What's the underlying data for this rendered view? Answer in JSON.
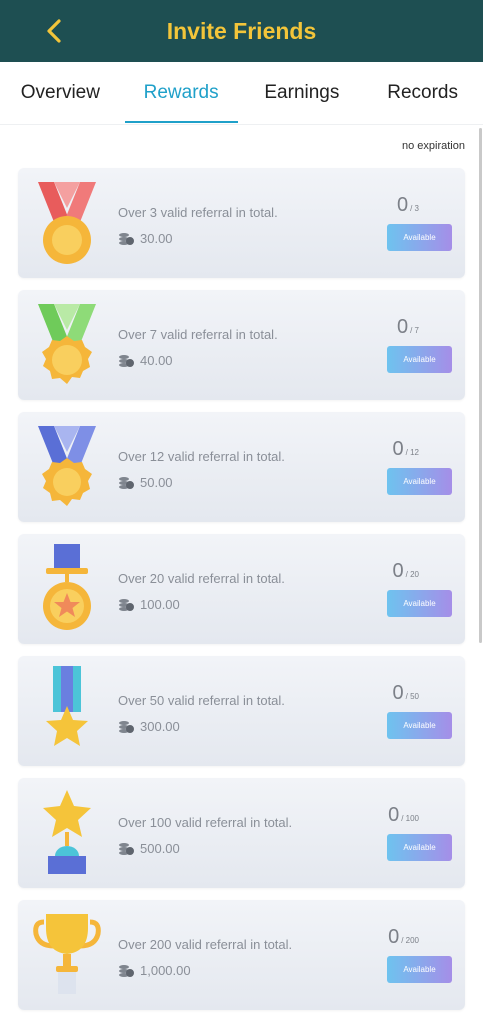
{
  "header": {
    "title": "Invite Friends",
    "back_icon": "chevron-left-icon",
    "bg": "#1e4f52",
    "title_color": "#f3c53a"
  },
  "tabs": [
    {
      "label": "Overview",
      "active": false
    },
    {
      "label": "Rewards",
      "active": true
    },
    {
      "label": "Earnings",
      "active": false
    },
    {
      "label": "Records",
      "active": false
    }
  ],
  "expiration_note": "no expiration",
  "rewards": [
    {
      "desc": "Over 3 valid referral in total.",
      "amount": "30.00",
      "current": "0",
      "total": "/ 3",
      "button": "Available",
      "icon": "red-ribbon-medal-icon"
    },
    {
      "desc": "Over 7 valid referral in total.",
      "amount": "40.00",
      "current": "0",
      "total": "/ 7",
      "button": "Available",
      "icon": "green-ribbon-medal-icon"
    },
    {
      "desc": "Over 12 valid referral in total.",
      "amount": "50.00",
      "current": "0",
      "total": "/ 12",
      "button": "Available",
      "icon": "blue-ribbon-medal-icon"
    },
    {
      "desc": "Over 20 valid referral in total.",
      "amount": "100.00",
      "current": "0",
      "total": "/ 20",
      "button": "Available",
      "icon": "star-medal-icon"
    },
    {
      "desc": "Over 50 valid referral in total.",
      "amount": "300.00",
      "current": "0",
      "total": "/ 50",
      "button": "Available",
      "icon": "star-ribbon-icon"
    },
    {
      "desc": "Over 100 valid referral in total.",
      "amount": "500.00",
      "current": "0",
      "total": "/ 100",
      "button": "Available",
      "icon": "star-trophy-icon"
    },
    {
      "desc": "Over 200 valid referral in total.",
      "amount": "1,000.00",
      "current": "0",
      "total": "/ 200",
      "button": "Available",
      "icon": "gold-cup-trophy-icon"
    }
  ]
}
